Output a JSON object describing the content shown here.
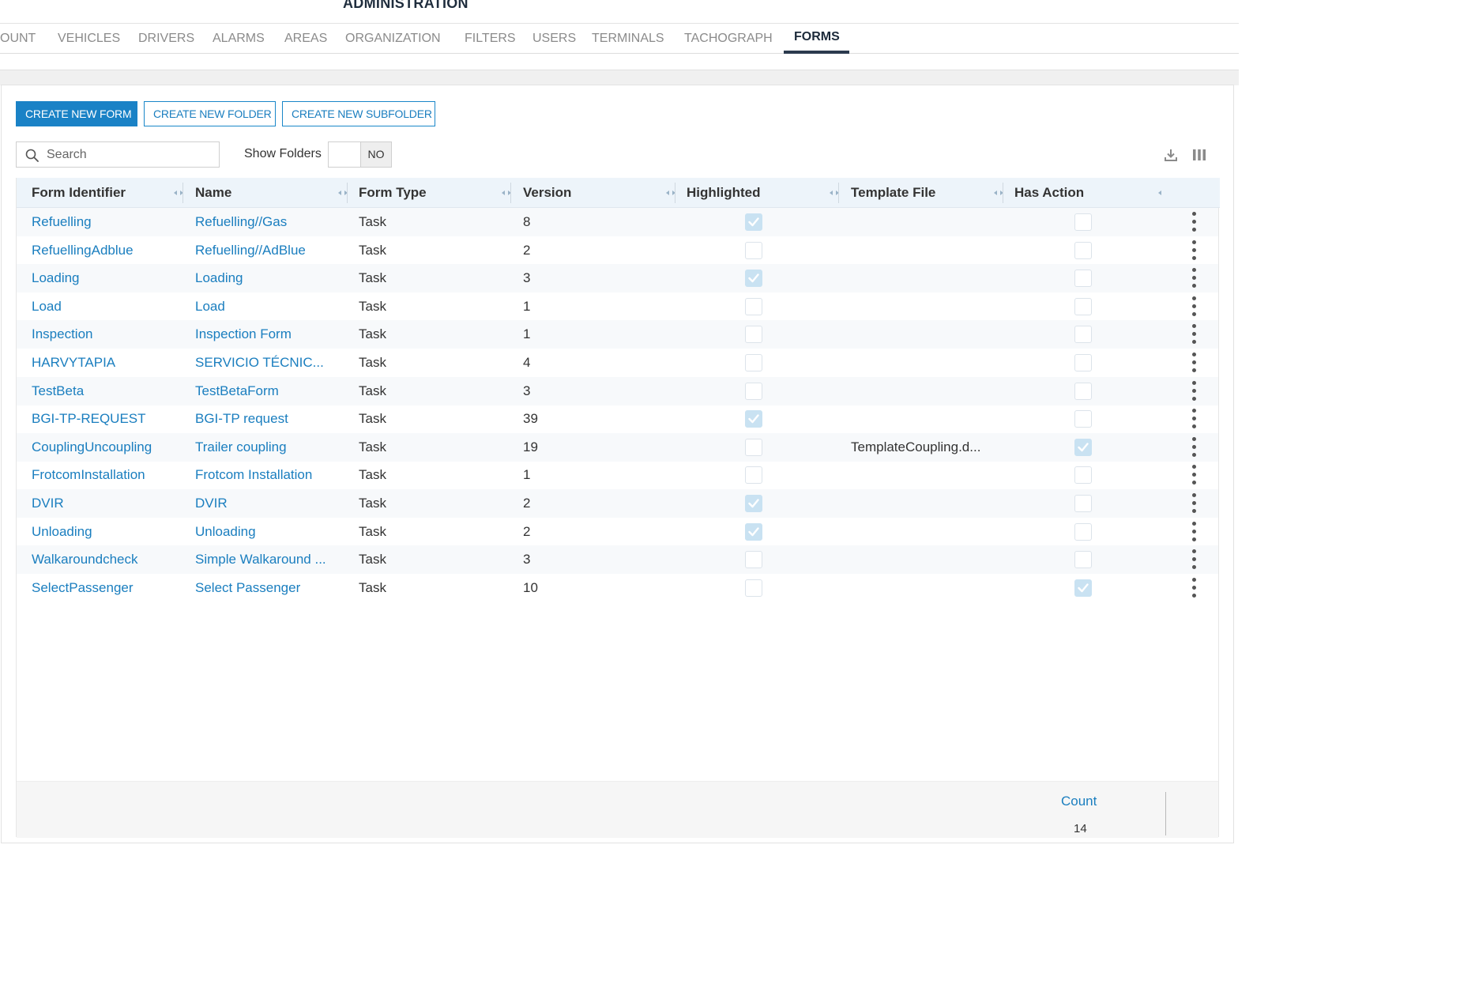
{
  "page": {
    "title": "ADMINISTRATION"
  },
  "tabs": [
    {
      "label": "OUNT",
      "active": false
    },
    {
      "label": "VEHICLES",
      "active": false
    },
    {
      "label": "DRIVERS",
      "active": false
    },
    {
      "label": "ALARMS",
      "active": false
    },
    {
      "label": "AREAS",
      "active": false
    },
    {
      "label": "ORGANIZATION",
      "active": false
    },
    {
      "label": "FILTERS",
      "active": false
    },
    {
      "label": "USERS",
      "active": false
    },
    {
      "label": "TERMINALS",
      "active": false
    },
    {
      "label": "TACHOGRAPH",
      "active": false
    },
    {
      "label": "FORMS",
      "active": true
    }
  ],
  "toolbar": {
    "create_form": "CREATE NEW FORM",
    "create_folder": "CREATE NEW FOLDER",
    "create_subfolder": "CREATE NEW SUBFOLDER"
  },
  "search": {
    "placeholder": "Search",
    "value": "",
    "icon": "search-icon"
  },
  "show_folders": {
    "label": "Show Folders",
    "state": "NO"
  },
  "tools": {
    "export_icon": "download-icon",
    "columns_icon": "columns-icon"
  },
  "grid": {
    "columns": [
      {
        "key": "identifier",
        "label": "Form Identifier"
      },
      {
        "key": "name",
        "label": "Name"
      },
      {
        "key": "type",
        "label": "Form Type"
      },
      {
        "key": "version",
        "label": "Version"
      },
      {
        "key": "highlighted",
        "label": "Highlighted"
      },
      {
        "key": "template",
        "label": "Template File"
      },
      {
        "key": "has_action",
        "label": "Has Action"
      }
    ],
    "rows": [
      {
        "identifier": "Refuelling",
        "name": "Refuelling//Gas",
        "type": "Task",
        "version": "8",
        "highlighted": true,
        "template": "",
        "has_action": false
      },
      {
        "identifier": "RefuellingAdblue",
        "name": "Refuelling//AdBlue",
        "type": "Task",
        "version": "2",
        "highlighted": false,
        "template": "",
        "has_action": false
      },
      {
        "identifier": "Loading",
        "name": "Loading",
        "type": "Task",
        "version": "3",
        "highlighted": true,
        "template": "",
        "has_action": false
      },
      {
        "identifier": "Load",
        "name": "Load",
        "type": "Task",
        "version": "1",
        "highlighted": false,
        "template": "",
        "has_action": false
      },
      {
        "identifier": "Inspection",
        "name": "Inspection Form",
        "type": "Task",
        "version": "1",
        "highlighted": false,
        "template": "",
        "has_action": false
      },
      {
        "identifier": "HARVYTAPIA",
        "name": "SERVICIO TÉCNIC...",
        "type": "Task",
        "version": "4",
        "highlighted": false,
        "template": "",
        "has_action": false
      },
      {
        "identifier": "TestBeta",
        "name": "TestBetaForm",
        "type": "Task",
        "version": "3",
        "highlighted": false,
        "template": "",
        "has_action": false
      },
      {
        "identifier": "BGI-TP-REQUEST",
        "name": "BGI-TP request",
        "type": "Task",
        "version": "39",
        "highlighted": true,
        "template": "",
        "has_action": false
      },
      {
        "identifier": "CouplingUncoupling",
        "name": "Trailer coupling",
        "type": "Task",
        "version": "19",
        "highlighted": false,
        "template": "TemplateCoupling.d...",
        "has_action": true
      },
      {
        "identifier": "FrotcomInstallation",
        "name": "Frotcom Installation",
        "type": "Task",
        "version": "1",
        "highlighted": false,
        "template": "",
        "has_action": false
      },
      {
        "identifier": "DVIR",
        "name": "DVIR",
        "type": "Task",
        "version": "2",
        "highlighted": true,
        "template": "",
        "has_action": false
      },
      {
        "identifier": "Unloading",
        "name": "Unloading",
        "type": "Task",
        "version": "2",
        "highlighted": true,
        "template": "",
        "has_action": false
      },
      {
        "identifier": "Walkaroundcheck",
        "name": "Simple Walkaround ...",
        "type": "Task",
        "version": "3",
        "highlighted": false,
        "template": "",
        "has_action": false
      },
      {
        "identifier": "SelectPassenger",
        "name": "Select Passenger",
        "type": "Task",
        "version": "10",
        "highlighted": false,
        "template": "",
        "has_action": true
      }
    ]
  },
  "footer": {
    "count_label": "Count",
    "count_value": "14"
  },
  "colors": {
    "accent": "#1a82c6",
    "link": "#1a7ebf",
    "header_bg": "#edf4fa",
    "check_fill": "#c9e2f2"
  }
}
